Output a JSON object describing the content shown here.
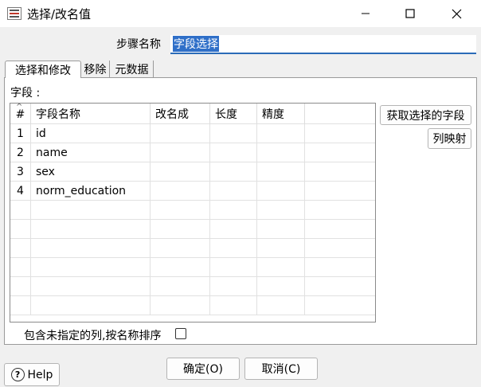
{
  "window": {
    "title": "选择/改名值",
    "controls": [
      "minimize-icon",
      "maximize-icon",
      "close-icon"
    ]
  },
  "step": {
    "label": "步骤名称",
    "value": "字段选择"
  },
  "tabs": [
    {
      "label": "选择和修改",
      "active": true
    },
    {
      "label": "移除",
      "active": false
    },
    {
      "label": "元数据",
      "active": false
    }
  ],
  "fields": {
    "label": "字段 :",
    "columns": [
      "#",
      "字段名称",
      "改名成",
      "长度",
      "精度",
      ""
    ],
    "rows": [
      {
        "num": "1",
        "name": "id",
        "rename": "",
        "length": "",
        "precision": ""
      },
      {
        "num": "2",
        "name": "name",
        "rename": "",
        "length": "",
        "precision": ""
      },
      {
        "num": "3",
        "name": "sex",
        "rename": "",
        "length": "",
        "precision": ""
      },
      {
        "num": "4",
        "name": "norm_education",
        "rename": "",
        "length": "",
        "precision": ""
      }
    ]
  },
  "side_buttons": {
    "get_fields": "获取选择的字段",
    "mapping": "列映射"
  },
  "include_unspecified": {
    "label": "包含未指定的列,按名称排序",
    "checked": false
  },
  "buttons": {
    "help": "Help",
    "ok": "确定(O)",
    "cancel": "取消(C)"
  },
  "colors": {
    "accent": "#2f6fc8",
    "dialog_bg": "#f0f0f0"
  }
}
